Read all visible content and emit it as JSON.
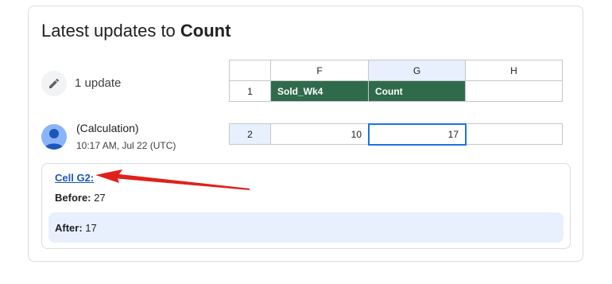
{
  "title": {
    "prefix": "Latest updates to ",
    "name": "Count"
  },
  "summary": {
    "update_count": "1 update"
  },
  "author": {
    "name": "(Calculation)",
    "timestamp": "10:17 AM, Jul 22 (UTC)"
  },
  "sheet_header": {
    "columns": [
      "F",
      "G",
      "H"
    ],
    "row1_number": "1",
    "row1_cells": [
      "Sold_Wk4",
      "Count",
      ""
    ]
  },
  "sheet_row": {
    "row_number": "2",
    "cells": [
      "10",
      "17",
      ""
    ]
  },
  "change": {
    "cell_link": "Cell G2:",
    "before_label": "Before:",
    "before_value": " 27",
    "after_label": "After:",
    "after_value": " 17"
  },
  "colors": {
    "header_green": "#2f6b4a",
    "selected_blue": "#e8f0fe",
    "link": "#1a57b8",
    "arrow": "#e0201b"
  },
  "icons": [
    "pencil-icon",
    "person-icon",
    "arrow-annotation"
  ]
}
